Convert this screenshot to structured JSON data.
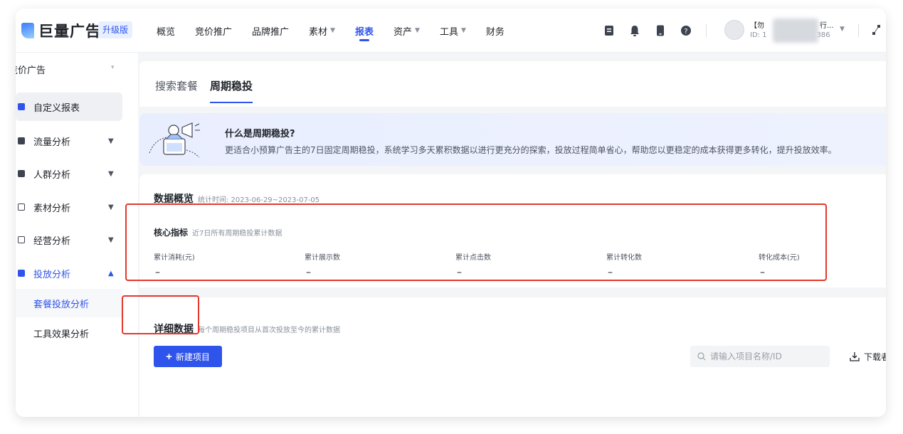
{
  "brand": {
    "name": "巨量广告",
    "badge": "升级版"
  },
  "nav": [
    {
      "label": "概览",
      "dropdown": false,
      "active": false
    },
    {
      "label": "竞价推广",
      "dropdown": false,
      "active": false
    },
    {
      "label": "品牌推广",
      "dropdown": false,
      "active": false
    },
    {
      "label": "素材",
      "dropdown": true,
      "active": false
    },
    {
      "label": "报表",
      "dropdown": false,
      "active": true
    },
    {
      "label": "资产",
      "dropdown": true,
      "active": false
    },
    {
      "label": "工具",
      "dropdown": true,
      "active": false
    },
    {
      "label": "财务",
      "dropdown": false,
      "active": false
    }
  ],
  "account": {
    "name": "【勿",
    "name_tail": "行...",
    "id_prefix": "ID: 1",
    "id_suffix": "386"
  },
  "colors": {
    "accent": "#2f54eb",
    "highlight": "#e5372c"
  },
  "sidebar": {
    "head": "竞价广告",
    "items": [
      {
        "label": "自定义报表"
      },
      {
        "label": "流量分析"
      },
      {
        "label": "人群分析"
      },
      {
        "label": "素材分析"
      },
      {
        "label": "经营分析"
      },
      {
        "label": "投放分析"
      }
    ],
    "sub_items": [
      {
        "label": "套餐投放分析"
      },
      {
        "label": "工具效果分析"
      }
    ]
  },
  "tabs": [
    {
      "label": "搜索套餐",
      "active": false
    },
    {
      "label": "周期稳投",
      "active": true
    }
  ],
  "banner": {
    "title": "什么是周期稳投?",
    "desc": "更适合小预算广告主的7日固定周期稳投，系统学习多天累积数据以进行更充分的探索，投放过程简单省心，帮助您以更稳定的成本获得更多转化，提升投放效率。"
  },
  "overview": {
    "title": "数据概览",
    "stat_time": "统计时间: 2023-06-29~2023-07-05"
  },
  "core": {
    "title": "核心指标",
    "subtitle": "近7日所有周期稳投累计数据",
    "metrics": [
      {
        "label": "累计消耗(元)",
        "value": "–"
      },
      {
        "label": "累计展示数",
        "value": "–"
      },
      {
        "label": "累计点击数",
        "value": "–"
      },
      {
        "label": "累计转化数",
        "value": "–"
      },
      {
        "label": "转化成本(元)",
        "value": "–"
      }
    ]
  },
  "detail": {
    "title": "详细数据",
    "subtitle": "每个周期稳投项目从首次投放至今的累计数据",
    "new_button": "新建项目",
    "search_placeholder": "请输入项目名称/ID",
    "download_label": "下载者"
  }
}
